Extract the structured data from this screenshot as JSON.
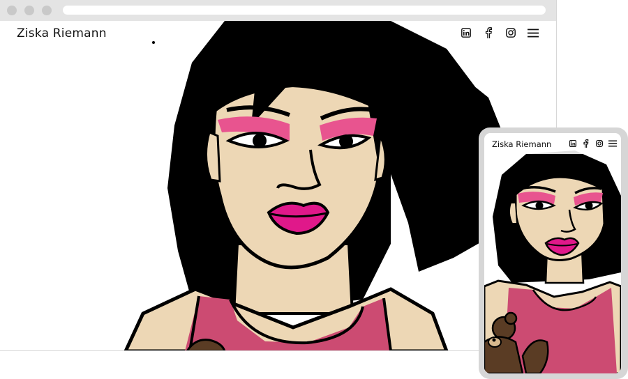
{
  "desktop": {
    "site_name": "Ziska Riemann",
    "nav_icons": [
      "linkedin-icon",
      "facebook-icon",
      "instagram-icon",
      "hamburger-menu-icon"
    ]
  },
  "mobile": {
    "site_name": "Ziska Riemann",
    "nav_icons": [
      "linkedin-icon",
      "facebook-icon",
      "instagram-icon",
      "hamburger-menu-icon"
    ]
  },
  "colors": {
    "skin": "#edd7b5",
    "hair": "#000000",
    "eyeshadow": "#e8548f",
    "lips": "#e0188a",
    "top": "#cc4b72",
    "bear": "#5a3c24"
  }
}
